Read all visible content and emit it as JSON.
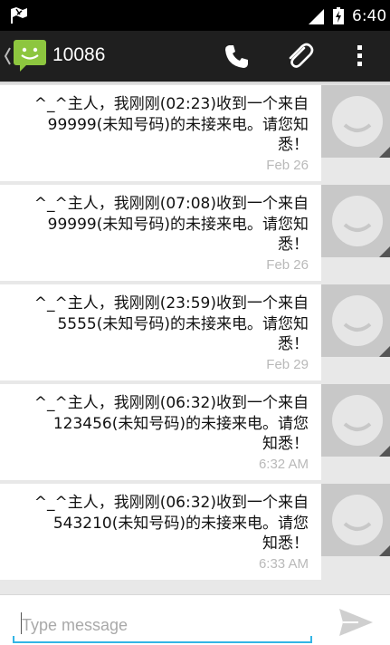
{
  "status_bar": {
    "time": "6:40"
  },
  "action_bar": {
    "title": "10086"
  },
  "messages": [
    {
      "text": "^_^主人，我刚刚(02:23)收到一个来自\n99999(未知号码)的未接来电。请您知\n悉！",
      "timestamp": "Feb 26"
    },
    {
      "text": "^_^主人，我刚刚(07:08)收到一个来自\n99999(未知号码)的未接来电。请您知\n悉！",
      "timestamp": "Feb 26"
    },
    {
      "text": "^_^主人，我刚刚(23:59)收到一个来自\n5555(未知号码)的未接来电。请您知\n悉！",
      "timestamp": "Feb 29"
    },
    {
      "text": "^_^主人，我刚刚(06:32)收到一个来自\n123456(未知号码)的未接来电。请您\n知悉！",
      "timestamp": "6:32 AM"
    },
    {
      "text": "^_^主人，我刚刚(06:32)收到一个来自\n543210(未知号码)的未接来电。请您\n知悉！",
      "timestamp": "6:33 AM"
    }
  ],
  "compose": {
    "placeholder": "Type message"
  },
  "colors": {
    "accent": "#33b5e5",
    "app_green": "#8dc63f",
    "action_bar": "#1f1f1f"
  }
}
